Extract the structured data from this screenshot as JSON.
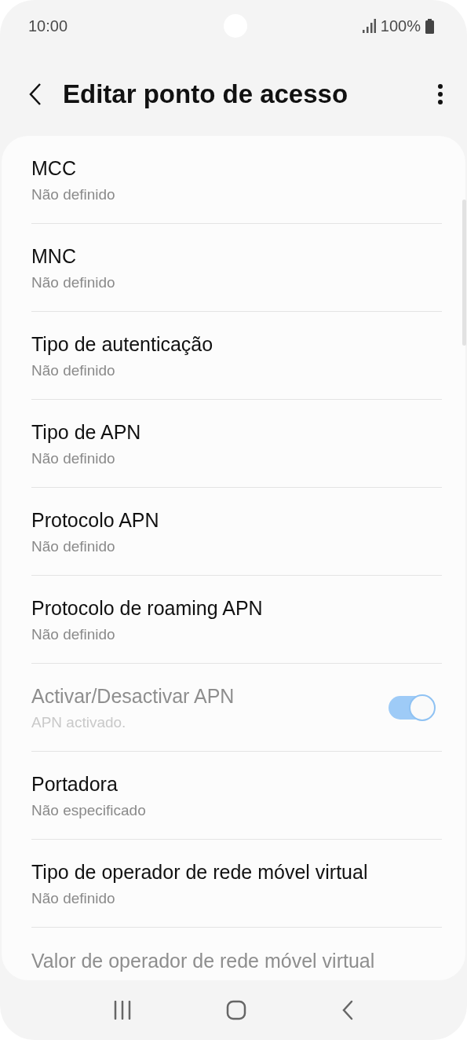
{
  "status_bar": {
    "time": "10:00",
    "battery": "100%"
  },
  "header": {
    "title": "Editar ponto de acesso"
  },
  "settings": [
    {
      "kind": "text",
      "title": "MCC",
      "subtitle": "Não definido",
      "disabled": false
    },
    {
      "kind": "text",
      "title": "MNC",
      "subtitle": "Não definido",
      "disabled": false
    },
    {
      "kind": "text",
      "title": "Tipo de autenticação",
      "subtitle": "Não definido",
      "disabled": false
    },
    {
      "kind": "text",
      "title": "Tipo de APN",
      "subtitle": "Não definido",
      "disabled": false
    },
    {
      "kind": "text",
      "title": "Protocolo APN",
      "subtitle": "Não definido",
      "disabled": false
    },
    {
      "kind": "text",
      "title": "Protocolo de roaming APN",
      "subtitle": "Não definido",
      "disabled": false
    },
    {
      "kind": "toggle",
      "title": "Activar/Desactivar APN",
      "subtitle": "APN activado.",
      "disabled": true,
      "on": true
    },
    {
      "kind": "text",
      "title": "Portadora",
      "subtitle": "Não especificado",
      "disabled": false
    },
    {
      "kind": "text",
      "title": "Tipo de operador de rede móvel virtual",
      "subtitle": "Não definido",
      "disabled": false
    },
    {
      "kind": "text",
      "title": "Valor de operador de rede móvel virtual",
      "disabled": true
    }
  ]
}
